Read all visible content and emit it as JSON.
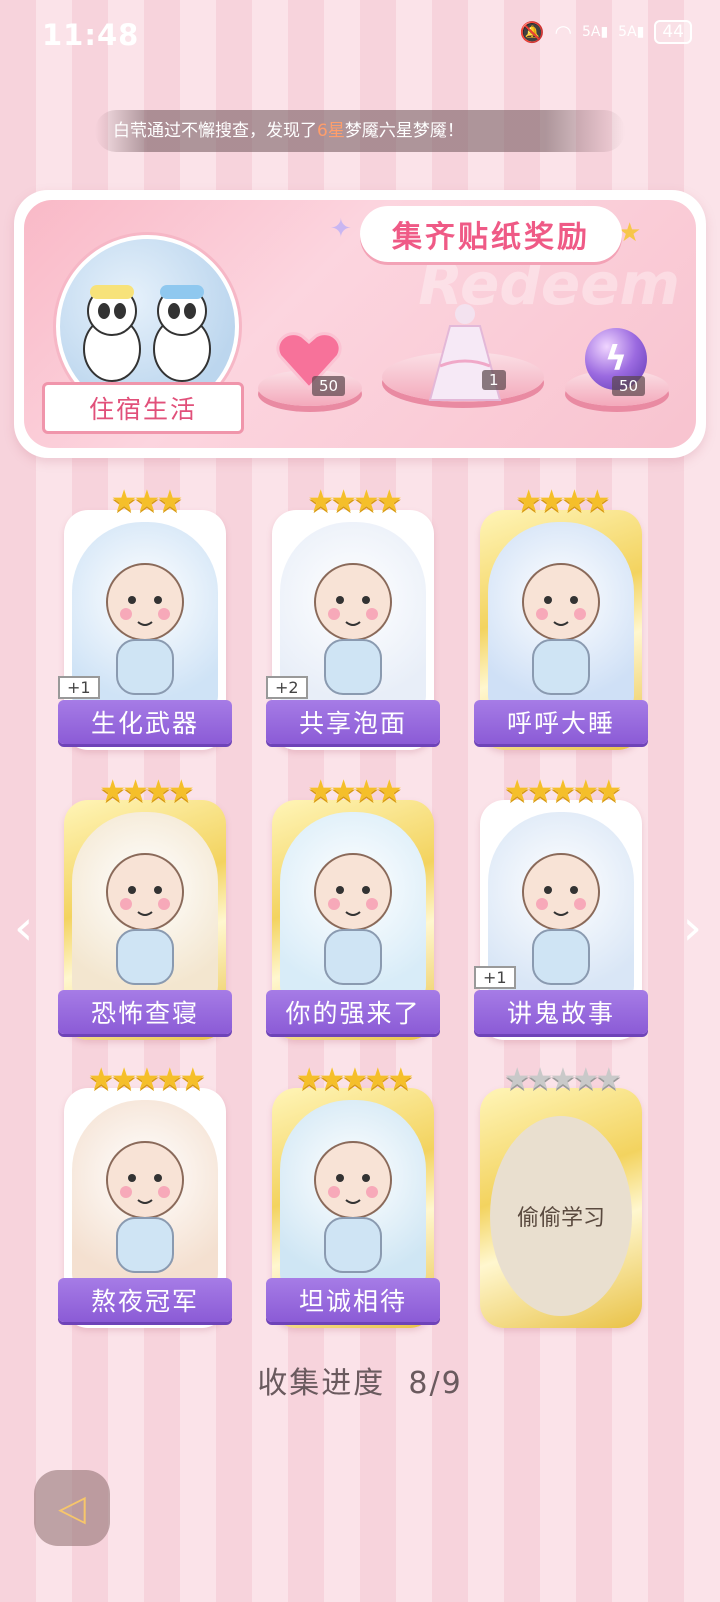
{
  "status_bar": {
    "time": "11:48",
    "network1": "5A",
    "network2": "5A",
    "battery": "44"
  },
  "ticker": {
    "prefix": "白茕通过不懈搜查，发现了",
    "highlight": "6星",
    "suffix": "梦魇六星梦魇！"
  },
  "reward_panel": {
    "title": "集齐贴纸奖励",
    "watermark": "Redeem",
    "album_label": "住宿生活",
    "rewards": [
      {
        "icon": "heart-gem-icon",
        "count": "50"
      },
      {
        "icon": "dress-icon",
        "count": "1"
      },
      {
        "icon": "energy-orb-icon",
        "count": "50"
      }
    ]
  },
  "cards": [
    {
      "label": "生化武器",
      "stars": "★★★",
      "plus": "+1",
      "frame": "white"
    },
    {
      "label": "共享泡面",
      "stars": "★★★★",
      "plus": "+2",
      "frame": "white"
    },
    {
      "label": "呼呼大睡",
      "stars": "★★★★",
      "plus": "",
      "frame": "gold"
    },
    {
      "label": "恐怖查寝",
      "stars": "★★★★",
      "plus": "",
      "frame": "gold"
    },
    {
      "label": "你的强来了",
      "stars": "★★★★",
      "plus": "",
      "frame": "gold"
    },
    {
      "label": "讲鬼故事",
      "stars": "★★★★★",
      "plus": "+1",
      "frame": "white"
    },
    {
      "label": "熬夜冠军",
      "stars": "★★★★★",
      "plus": "",
      "frame": "white"
    },
    {
      "label": "坦诚相待",
      "stars": "★★★★★",
      "plus": "",
      "frame": "gold"
    },
    {
      "label": "偷偷学习",
      "stars": "★★★★★",
      "plus": "",
      "frame": "gold",
      "locked": true
    }
  ],
  "progress": {
    "label": "收集进度",
    "value": "8/9"
  },
  "nav": {
    "prev": "‹",
    "next": "›"
  }
}
